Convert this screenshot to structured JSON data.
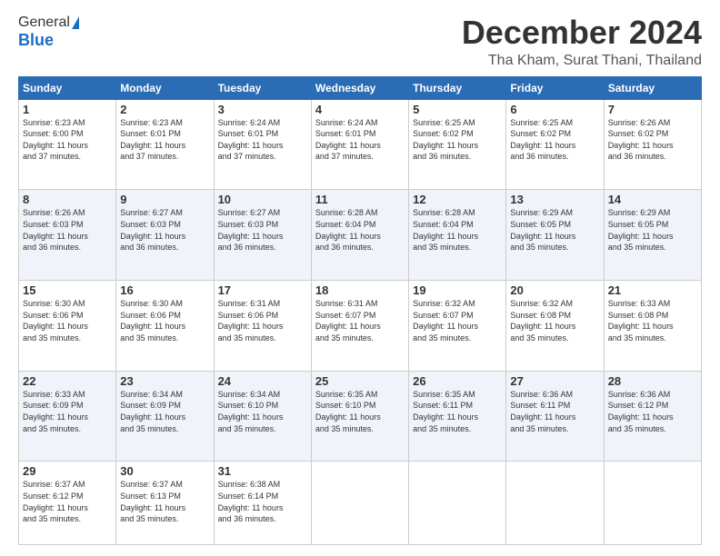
{
  "logo": {
    "general": "General",
    "blue": "Blue"
  },
  "title": "December 2024",
  "location": "Tha Kham, Surat Thani, Thailand",
  "headers": [
    "Sunday",
    "Monday",
    "Tuesday",
    "Wednesday",
    "Thursday",
    "Friday",
    "Saturday"
  ],
  "weeks": [
    [
      {
        "day": "1",
        "info": "Sunrise: 6:23 AM\nSunset: 6:00 PM\nDaylight: 11 hours\nand 37 minutes."
      },
      {
        "day": "2",
        "info": "Sunrise: 6:23 AM\nSunset: 6:01 PM\nDaylight: 11 hours\nand 37 minutes."
      },
      {
        "day": "3",
        "info": "Sunrise: 6:24 AM\nSunset: 6:01 PM\nDaylight: 11 hours\nand 37 minutes."
      },
      {
        "day": "4",
        "info": "Sunrise: 6:24 AM\nSunset: 6:01 PM\nDaylight: 11 hours\nand 37 minutes."
      },
      {
        "day": "5",
        "info": "Sunrise: 6:25 AM\nSunset: 6:02 PM\nDaylight: 11 hours\nand 36 minutes."
      },
      {
        "day": "6",
        "info": "Sunrise: 6:25 AM\nSunset: 6:02 PM\nDaylight: 11 hours\nand 36 minutes."
      },
      {
        "day": "7",
        "info": "Sunrise: 6:26 AM\nSunset: 6:02 PM\nDaylight: 11 hours\nand 36 minutes."
      }
    ],
    [
      {
        "day": "8",
        "info": "Sunrise: 6:26 AM\nSunset: 6:03 PM\nDaylight: 11 hours\nand 36 minutes."
      },
      {
        "day": "9",
        "info": "Sunrise: 6:27 AM\nSunset: 6:03 PM\nDaylight: 11 hours\nand 36 minutes."
      },
      {
        "day": "10",
        "info": "Sunrise: 6:27 AM\nSunset: 6:03 PM\nDaylight: 11 hours\nand 36 minutes."
      },
      {
        "day": "11",
        "info": "Sunrise: 6:28 AM\nSunset: 6:04 PM\nDaylight: 11 hours\nand 36 minutes."
      },
      {
        "day": "12",
        "info": "Sunrise: 6:28 AM\nSunset: 6:04 PM\nDaylight: 11 hours\nand 35 minutes."
      },
      {
        "day": "13",
        "info": "Sunrise: 6:29 AM\nSunset: 6:05 PM\nDaylight: 11 hours\nand 35 minutes."
      },
      {
        "day": "14",
        "info": "Sunrise: 6:29 AM\nSunset: 6:05 PM\nDaylight: 11 hours\nand 35 minutes."
      }
    ],
    [
      {
        "day": "15",
        "info": "Sunrise: 6:30 AM\nSunset: 6:06 PM\nDaylight: 11 hours\nand 35 minutes."
      },
      {
        "day": "16",
        "info": "Sunrise: 6:30 AM\nSunset: 6:06 PM\nDaylight: 11 hours\nand 35 minutes."
      },
      {
        "day": "17",
        "info": "Sunrise: 6:31 AM\nSunset: 6:06 PM\nDaylight: 11 hours\nand 35 minutes."
      },
      {
        "day": "18",
        "info": "Sunrise: 6:31 AM\nSunset: 6:07 PM\nDaylight: 11 hours\nand 35 minutes."
      },
      {
        "day": "19",
        "info": "Sunrise: 6:32 AM\nSunset: 6:07 PM\nDaylight: 11 hours\nand 35 minutes."
      },
      {
        "day": "20",
        "info": "Sunrise: 6:32 AM\nSunset: 6:08 PM\nDaylight: 11 hours\nand 35 minutes."
      },
      {
        "day": "21",
        "info": "Sunrise: 6:33 AM\nSunset: 6:08 PM\nDaylight: 11 hours\nand 35 minutes."
      }
    ],
    [
      {
        "day": "22",
        "info": "Sunrise: 6:33 AM\nSunset: 6:09 PM\nDaylight: 11 hours\nand 35 minutes."
      },
      {
        "day": "23",
        "info": "Sunrise: 6:34 AM\nSunset: 6:09 PM\nDaylight: 11 hours\nand 35 minutes."
      },
      {
        "day": "24",
        "info": "Sunrise: 6:34 AM\nSunset: 6:10 PM\nDaylight: 11 hours\nand 35 minutes."
      },
      {
        "day": "25",
        "info": "Sunrise: 6:35 AM\nSunset: 6:10 PM\nDaylight: 11 hours\nand 35 minutes."
      },
      {
        "day": "26",
        "info": "Sunrise: 6:35 AM\nSunset: 6:11 PM\nDaylight: 11 hours\nand 35 minutes."
      },
      {
        "day": "27",
        "info": "Sunrise: 6:36 AM\nSunset: 6:11 PM\nDaylight: 11 hours\nand 35 minutes."
      },
      {
        "day": "28",
        "info": "Sunrise: 6:36 AM\nSunset: 6:12 PM\nDaylight: 11 hours\nand 35 minutes."
      }
    ],
    [
      {
        "day": "29",
        "info": "Sunrise: 6:37 AM\nSunset: 6:12 PM\nDaylight: 11 hours\nand 35 minutes."
      },
      {
        "day": "30",
        "info": "Sunrise: 6:37 AM\nSunset: 6:13 PM\nDaylight: 11 hours\nand 35 minutes."
      },
      {
        "day": "31",
        "info": "Sunrise: 6:38 AM\nSunset: 6:14 PM\nDaylight: 11 hours\nand 36 minutes."
      },
      {
        "day": "",
        "info": ""
      },
      {
        "day": "",
        "info": ""
      },
      {
        "day": "",
        "info": ""
      },
      {
        "day": "",
        "info": ""
      }
    ]
  ]
}
